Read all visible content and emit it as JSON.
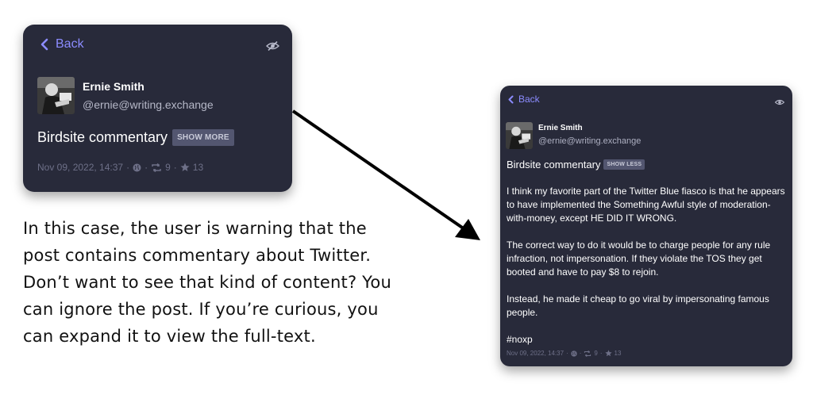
{
  "left_panel": {
    "back_label": "Back",
    "author_name": "Ernie Smith",
    "author_handle": "@ernie@writing.exchange",
    "content_warning": "Birdsite commentary",
    "toggle_label": "SHOW MORE",
    "timestamp": "Nov 09, 2022, 14:37",
    "boost_count": "9",
    "favorite_count": "13",
    "visibility_icon": "eye-slash-icon"
  },
  "right_panel": {
    "back_label": "Back",
    "author_name": "Ernie Smith",
    "author_handle": "@ernie@writing.exchange",
    "content_warning": "Birdsite commentary",
    "toggle_label": "SHOW LESS",
    "paragraphs": [
      "I think my favorite part of the Twitter Blue fiasco is that he appears to have implemented the Something Awful style of moderation-with-money, except HE DID IT WRONG.",
      "The correct way to do it would be to charge people for any rule infraction, not impersonation. If they violate the TOS they get booted and have to pay $8 to rejoin.",
      "Instead, he made it cheap to go viral by impersonating famous people.",
      "#noxp"
    ],
    "timestamp": "Nov 09, 2022, 14:37",
    "boost_count": "9",
    "favorite_count": "13",
    "visibility_icon": "eye-icon"
  },
  "caption": "In this case, the user is warning that the post contains commentary about Twitter. Don’t want to see that kind of content? You can ignore the post. If you’re curious, you can expand it to view the full-text.",
  "colors": {
    "card_background": "#282a3a",
    "accent": "#8c8cff",
    "muted_text": "#6e7088",
    "button_background": "#535670"
  }
}
